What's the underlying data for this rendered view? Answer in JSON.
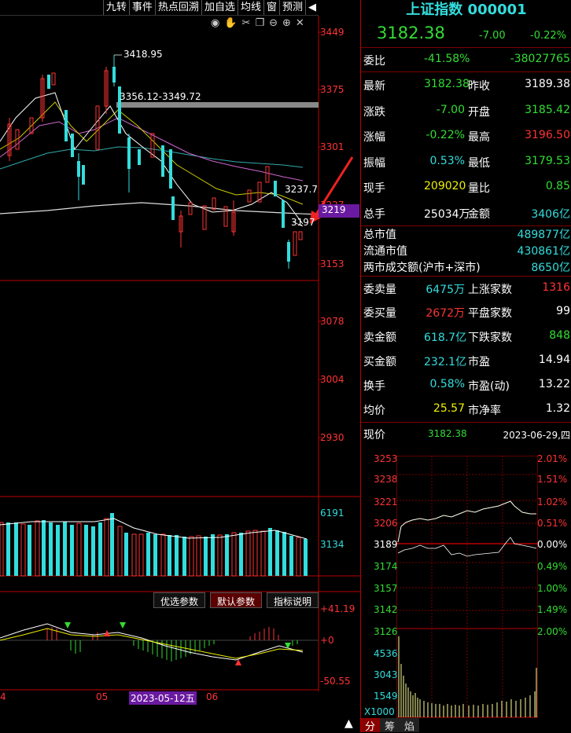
{
  "toolbar": {
    "items": [
      "九转",
      "事件",
      "热点回溯",
      "加自选",
      "均线",
      "窗",
      "预测",
      "◀"
    ]
  },
  "chart_icons": [
    "eye-icon",
    "hand-icon",
    "scissors-icon",
    "copy-icon",
    "zoom-out-icon",
    "zoom-in-icon",
    "close-icon"
  ],
  "price_axis": [
    "3449",
    "3375",
    "3301",
    "3227",
    "3153",
    "3078",
    "3004",
    "2930"
  ],
  "highlight_price": "3219",
  "annotations": {
    "high": "3418.95",
    "range": "3356.12-3349.72",
    "mid": "3237.7",
    "last": "3197"
  },
  "volume_axis": [
    "6191",
    "3134"
  ],
  "macd_axis": [
    "+41.19",
    "+0",
    "-50.55"
  ],
  "param_tabs": [
    "优选参数",
    "默认参数",
    "指标说明"
  ],
  "date_axis": {
    "a": "05",
    "b": "2023-05-12五",
    "c": "06",
    "d": "4"
  },
  "bottom_tabs": [
    "分",
    "筹",
    "焰"
  ],
  "panel": {
    "title": "上证指数 000001",
    "price": "3182.38",
    "change": "-7.00",
    "pct": "-0.22%",
    "rows": [
      {
        "l": "委比",
        "v": "-41.58%",
        "v2": "-38027765"
      },
      {
        "l": "最新",
        "v": "3182.38",
        "l2": "昨收",
        "v2": "3189.38"
      },
      {
        "l": "涨跌",
        "v": "-7.00",
        "l2": "开盘",
        "v2": "3185.42"
      },
      {
        "l": "涨幅",
        "v": "-0.22%",
        "l2": "最高",
        "v2": "3196.50"
      },
      {
        "l": "振幅",
        "v": "0.53%",
        "l2": "最低",
        "v2": "3179.53"
      },
      {
        "l": "现手",
        "v": "209020",
        "l2": "量比",
        "v2": "0.85"
      },
      {
        "l": "总手",
        "v": "25034万",
        "l2": "金额",
        "v2": "3406亿"
      }
    ],
    "mkt": [
      {
        "l": "总市值",
        "v": "489877亿"
      },
      {
        "l": "流通市值",
        "v": "430861亿"
      },
      {
        "l": "两市成交额(沪市+深市)",
        "v": "8650亿"
      }
    ],
    "rows2": [
      {
        "l": "委卖量",
        "v": "6475万",
        "l2": "上涨家数",
        "v2": "1316"
      },
      {
        "l": "委买量",
        "v": "2672万",
        "l2": "平盘家数",
        "v2": "99"
      },
      {
        "l": "卖金额",
        "v": "618.7亿",
        "l2": "下跌家数",
        "v2": "848"
      },
      {
        "l": "买金额",
        "v": "232.1亿",
        "l2": "市盈",
        "v2": "14.94"
      },
      {
        "l": "换手",
        "v": "0.58%",
        "l2": "市盈(动)",
        "v2": "13.22"
      },
      {
        "l": "均价",
        "v": "25.57",
        "l2": "市净率",
        "v2": "1.32"
      }
    ],
    "now_label": "现价",
    "now_price": "3182.38",
    "now_date": "2023-06-29,四",
    "intraday_left": [
      "3253",
      "3238",
      "3221",
      "3206",
      "3189",
      "3174",
      "3157",
      "3142",
      "3126"
    ],
    "intraday_right": [
      "1.51%",
      "1.02%",
      "0.51%",
      "0.00%",
      "0.49%",
      "1.00%",
      "1.49%",
      "2.00%"
    ],
    "intraday_top_right": "2.01%",
    "vol_left": [
      "4536",
      "3043",
      "1549",
      "X1000"
    ]
  }
}
